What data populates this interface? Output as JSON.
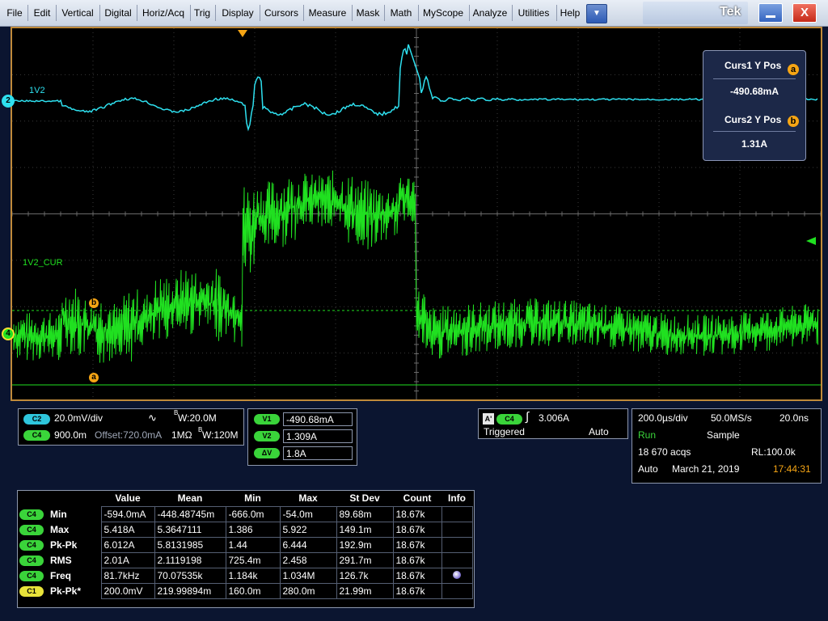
{
  "menu": {
    "items": [
      "File",
      "Edit",
      "Vertical",
      "Digital",
      "Horiz/Acq",
      "Trig",
      "Display",
      "Cursors",
      "Measure",
      "Mask",
      "Math",
      "MyScope",
      "Analyze",
      "Utilities",
      "Help"
    ],
    "dropdown_glyph": "▼",
    "brand": "Tek",
    "close_glyph": "X"
  },
  "traces": {
    "ch2": {
      "marker": "2",
      "label": "1V2",
      "color": "#2ee0ef"
    },
    "ch4": {
      "marker": "4",
      "label": "1V2_CUR",
      "color": "#20e020"
    }
  },
  "cursors": {
    "a": "a",
    "b": "b",
    "color": "#f6a514"
  },
  "cursor_readout": {
    "curs1_title": "Curs1 Y Pos",
    "curs1_value": "-490.68mA",
    "curs2_title": "Curs2 Y Pos",
    "curs2_value": "1.31A"
  },
  "channels": {
    "c2": {
      "pill": "C2",
      "scale": "20.0mV/div",
      "bw_prefix": "B",
      "bw": "W:20.0M"
    },
    "c4": {
      "pill": "C4",
      "scale": "900.0m",
      "offset": "Offset:720.0mA",
      "impedance": "1MΩ",
      "bw_prefix": "B",
      "bw": "W:120M"
    }
  },
  "delta": {
    "v1_label": "V1",
    "v1": "-490.68mA",
    "v2_label": "V2",
    "v2": "1.309A",
    "dv_label": "ΔV",
    "dv": "1.8A"
  },
  "trigger": {
    "a_badge": "A'",
    "source": "C4",
    "level": "3.006A",
    "state": "Triggered",
    "mode": "Auto"
  },
  "horizontal": {
    "time_div": "200.0µs/div",
    "sample_rate": "50.0MS/s",
    "resolution": "20.0ns",
    "run": "Run",
    "acq_mode": "Sample",
    "acqs": "18 670 acqs",
    "record_length": "RL:100.0k",
    "auto": "Auto",
    "date": "March 21, 2019",
    "time": "17:44:31"
  },
  "measurements": {
    "headers": [
      "Value",
      "Mean",
      "Min",
      "Max",
      "St Dev",
      "Count",
      "Info"
    ],
    "rows": [
      {
        "ch": "C4",
        "name": "Min",
        "cells": [
          "-594.0mA",
          "-448.48745m",
          "-666.0m",
          "-54.0m",
          "89.68m",
          "18.67k",
          ""
        ]
      },
      {
        "ch": "C4",
        "name": "Max",
        "cells": [
          "5.418A",
          "5.3647111",
          "1.386",
          "5.922",
          "149.1m",
          "18.67k",
          ""
        ]
      },
      {
        "ch": "C4",
        "name": "Pk-Pk",
        "cells": [
          "6.012A",
          "5.8131985",
          "1.44",
          "6.444",
          "192.9m",
          "18.67k",
          ""
        ]
      },
      {
        "ch": "C4",
        "name": "RMS",
        "cells": [
          "2.01A",
          "2.1119198",
          "725.4m",
          "2.458",
          "291.7m",
          "18.67k",
          ""
        ]
      },
      {
        "ch": "C4",
        "name": "Freq",
        "cells": [
          "81.7kHz",
          "70.07535k",
          "1.184k",
          "1.034M",
          "126.7k",
          "18.67k",
          ""
        ]
      },
      {
        "ch": "C1",
        "name": "Pk-Pk*",
        "cells": [
          "200.0mV",
          "219.99894m",
          "160.0m",
          "280.0m",
          "21.99m",
          "18.67k",
          ""
        ]
      }
    ]
  }
}
